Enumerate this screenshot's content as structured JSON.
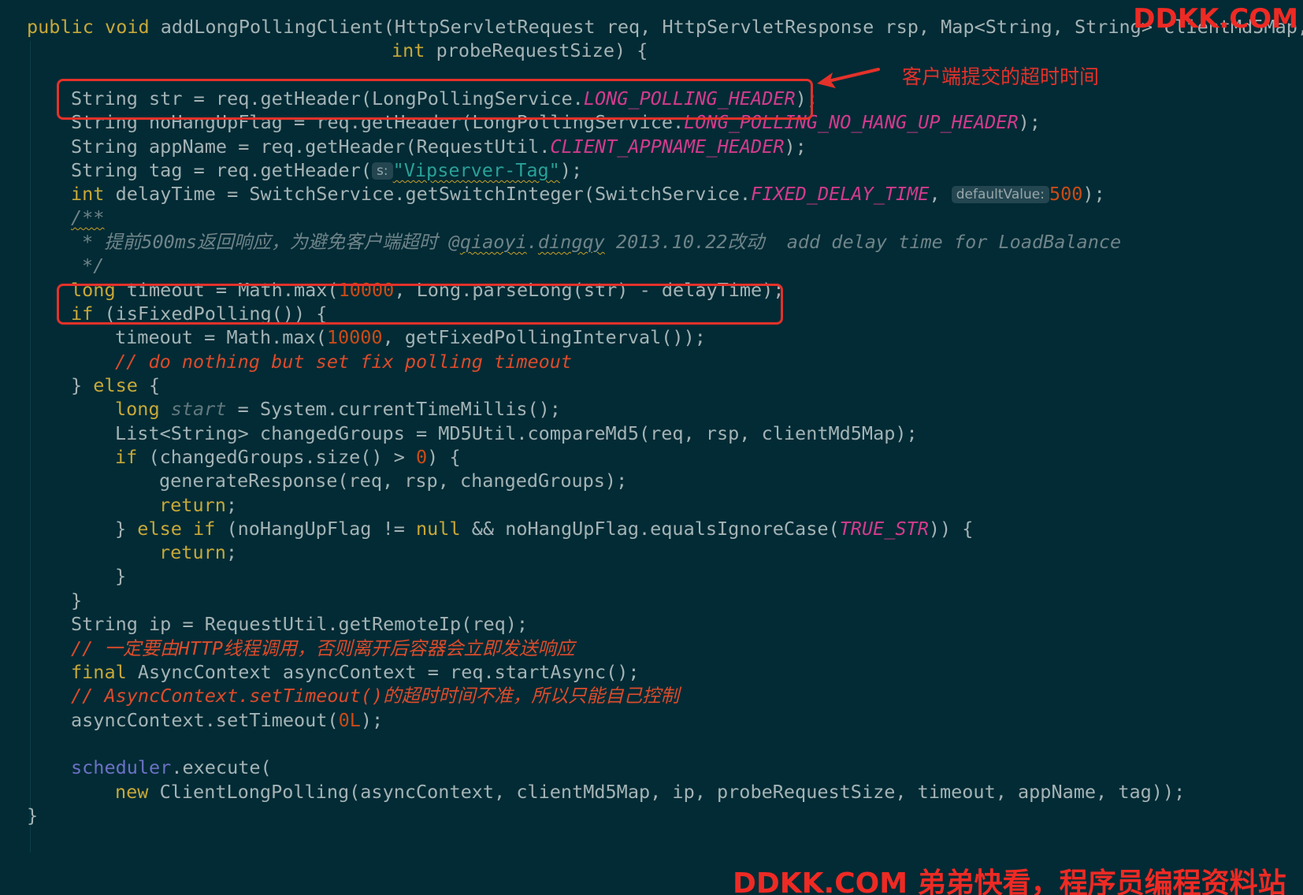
{
  "editor": {
    "theme_colors": {
      "background": "#022b35",
      "text": "#a4b3b5",
      "keyword": "#c7a838",
      "constant": "#d33b8e",
      "number": "#cb4b16",
      "string": "#2aa198",
      "highlight_box": "#e4312a"
    },
    "lines": [
      [
        "public",
        " ",
        "void",
        " addLongPollingClient(HttpServletRequest req, HttpServletResponse rsp, Map<String, String> clientMd5Map,"
      ],
      [
        "int",
        " probeRequestSize) {"
      ],
      [
        "String str = req.getHeader(LongPollingService.",
        "LONG_POLLING_HEADER",
        ");"
      ],
      [
        "String noHangUpFlag = req.getHeader(LongPollingService.",
        "LONG_POLLING_NO_HANG_UP_HEADER",
        ");"
      ],
      [
        "String appName = req.getHeader(RequestUtil.",
        "CLIENT_APPNAME_HEADER",
        ");"
      ],
      [
        "String tag = req.getHeader(",
        "s:",
        "\"Vipserver-Tag\"",
        ");"
      ],
      [
        "int",
        " delayTime = SwitchService.getSwitchInteger(SwitchService.",
        "FIXED_DELAY_TIME",
        ", ",
        "defaultValue:",
        "500",
        ");"
      ],
      [
        "/**"
      ],
      [
        "* 提前500ms返回响应，为避免客户端超时 @",
        "qiaoyi",
        ".",
        "dingqy",
        " 2013.10.22改动  add delay time for LoadBalance"
      ],
      [
        "*/"
      ],
      [
        "long",
        " timeout = Math.max(",
        "10000",
        ", Long.parseLong(str) - delayTime);"
      ],
      [
        "if",
        " (isFixedPolling()) {"
      ],
      [
        "timeout = Math.max(",
        "10000",
        ", getFixedPollingInterval());"
      ],
      [
        "// do nothing but set fix polling timeout"
      ],
      [
        "} ",
        "else",
        " {"
      ],
      [
        "long",
        " ",
        "start",
        " = System.currentTimeMillis();"
      ],
      [
        "List<String> changedGroups = MD5Util.compareMd5(req, rsp, clientMd5Map);"
      ],
      [
        "if",
        " (changedGroups.size() > ",
        "0",
        ") {"
      ],
      [
        "generateResponse(req, rsp, changedGroups);"
      ],
      [
        "return",
        ";"
      ],
      [
        "} ",
        "else if",
        " (noHangUpFlag != ",
        "null",
        " && noHangUpFlag.equalsIgnoreCase(",
        "TRUE_STR",
        ")) {"
      ],
      [
        "return",
        ";"
      ],
      [
        "}"
      ],
      [
        "}"
      ],
      [
        "String ip = RequestUtil.getRemoteIp(req);"
      ],
      [
        "// 一定要由HTTP线程调用，否则离开后容器会立即发送响应"
      ],
      [
        "final",
        " AsyncContext asyncContext = req.startAsync();"
      ],
      [
        "// AsyncContext.setTimeout()的超时时间不准，所以只能自己控制"
      ],
      [
        "asyncContext.setTimeout(",
        "0L",
        ");"
      ],
      [
        "scheduler",
        ".execute("
      ],
      [
        "new",
        " ClientLongPolling(asyncContext, clientMd5Map, ip, probeRequestSize, timeout, appName, tag));"
      ],
      [
        "}"
      ]
    ]
  },
  "annotation": {
    "label": "客户端提交的超时时间"
  },
  "watermark": {
    "top": "DDKK.COM",
    "bottom": "DDKK.COM 弟弟快看，程序员编程资料站"
  }
}
